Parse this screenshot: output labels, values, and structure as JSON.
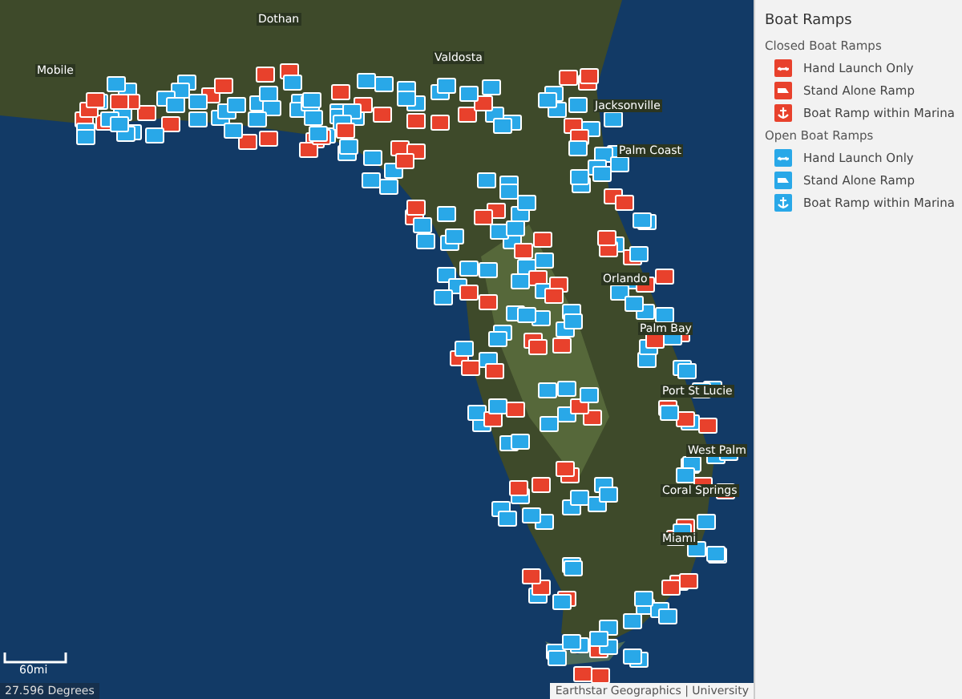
{
  "map": {
    "place_labels": [
      "Mobile",
      "Dothan",
      "Valdosta",
      "Jacksonville",
      "Palm Coast",
      "Orlando",
      "Palm Bay",
      "Port St Lucie",
      "West Palm",
      "Coral Springs",
      "Miami"
    ],
    "scale_label": "60mi",
    "coordinates": "27.596 Degrees",
    "attribution": "Earthstar Geographics | University"
  },
  "legend": {
    "title": "Boat Ramps",
    "groups": [
      {
        "title": "Closed Boat Ramps",
        "color": "#e8412c",
        "items": [
          {
            "kind": "hand",
            "label": "Hand Launch Only"
          },
          {
            "kind": "stand",
            "label": "Stand Alone Ramp"
          },
          {
            "kind": "marina",
            "label": "Boat Ramp within Marina"
          }
        ]
      },
      {
        "title": "Open Boat Ramps",
        "color": "#29a8e8",
        "items": [
          {
            "kind": "hand",
            "label": "Hand Launch Only"
          },
          {
            "kind": "stand",
            "label": "Stand Alone Ramp"
          },
          {
            "kind": "marina",
            "label": "Boat Ramp within Marina"
          }
        ]
      }
    ]
  }
}
